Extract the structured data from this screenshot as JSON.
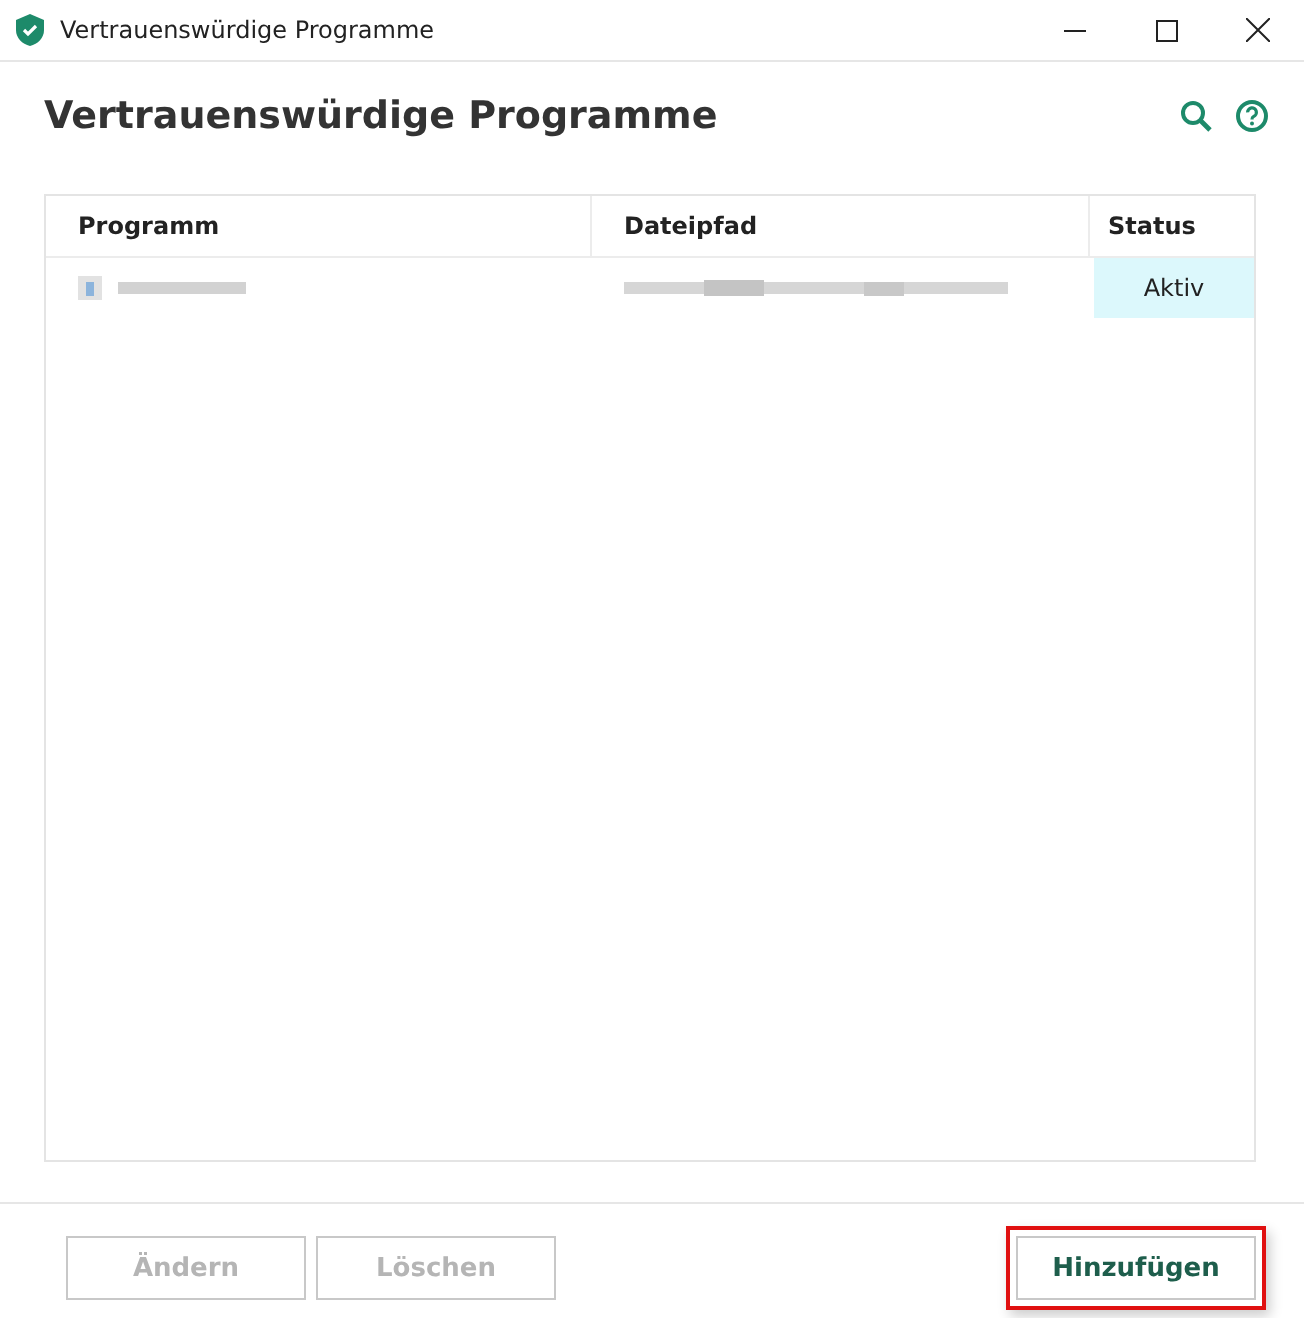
{
  "window": {
    "title": "Vertrauenswürdige Programme"
  },
  "heading": "Vertrauenswürdige Programme",
  "table": {
    "columns": [
      "Programm",
      "Dateipfad",
      "Status"
    ],
    "rows": [
      {
        "status": "Aktiv"
      }
    ]
  },
  "buttons": [
    {
      "label": "Ändern",
      "disabled": true,
      "highlighted": false
    },
    {
      "label": "Löschen",
      "disabled": true,
      "highlighted": false
    },
    {
      "label": "Hinzufügen",
      "disabled": false,
      "highlighted": true
    }
  ]
}
